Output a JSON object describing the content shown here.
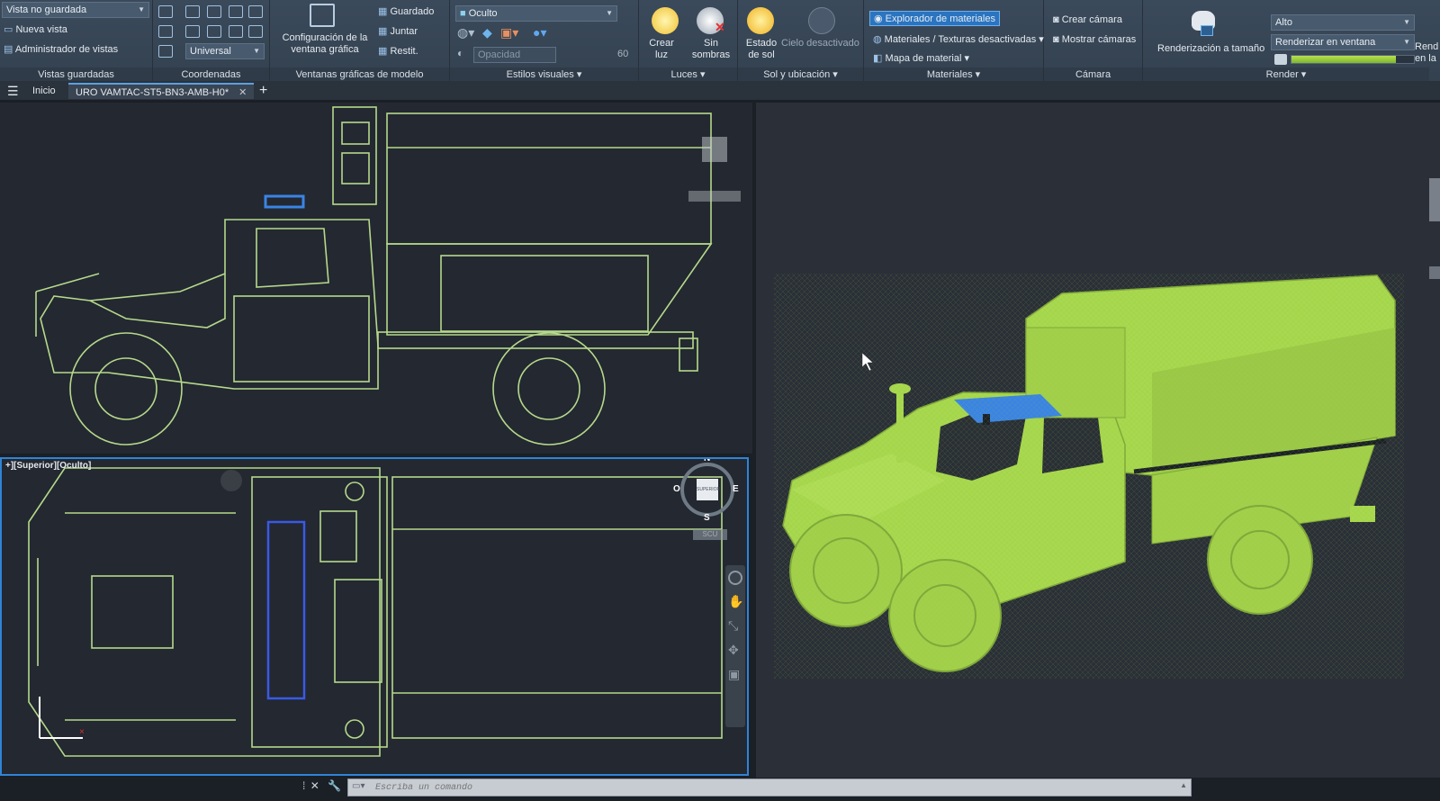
{
  "ribbon": {
    "views": {
      "current_view": "Vista no guardada",
      "new_view": "Nueva vista",
      "view_manager": "Administrador de vistas",
      "title": "Vistas guardadas"
    },
    "coordinates": {
      "ucs_combo": "Universal",
      "title": "Coordenadas"
    },
    "viewports": {
      "config_label": "Configuración de la ventana gráfica",
      "saved": "Guardado",
      "join": "Juntar",
      "restore": "Restit.",
      "title": "Ventanas gráficas de modelo"
    },
    "visual_styles": {
      "style_combo": "Oculto",
      "opacity_label": "Opacidad",
      "opacity_value": "60",
      "title": "Estilos visuales"
    },
    "lights": {
      "create_light": "Crear luz",
      "no_shadows": "Sin sombras",
      "title": "Luces"
    },
    "sun": {
      "sun_status": "Estado de sol",
      "sky_off": "Cielo desactivado",
      "title": "Sol y ubicación"
    },
    "materials": {
      "browser": "Explorador de materiales",
      "textures_off": "Materiales / Texturas desactivadas",
      "material_map": "Mapa de material",
      "title": "Materiales"
    },
    "camera": {
      "create_camera": "Crear cámara",
      "show_cameras": "Mostrar cámaras",
      "title": "Cámara"
    },
    "render": {
      "render_to_size": "Renderización a tamaño",
      "quality_combo": "Alto",
      "render_in": "Renderizar en ventana",
      "title": "Render",
      "partial_label": "Rend en la",
      "progress": 0.85
    }
  },
  "tabs": {
    "home": "Inicio",
    "file": "URO VAMTAC-ST5-BN3-AMB-H0*"
  },
  "viewports": {
    "bottom_label": "+][Superior][Oculto]",
    "viewcube": {
      "north": "N",
      "south": "S",
      "east": "E",
      "west": "O",
      "face": "SUPERIOR",
      "wcs": "SCU"
    }
  },
  "command_line": {
    "placeholder": "Escriba un comando"
  },
  "colors": {
    "wireframe": "#b6d98a",
    "model": "#a8d84e",
    "light_bar": "#3a84e4",
    "accent": "#2f84d6"
  }
}
